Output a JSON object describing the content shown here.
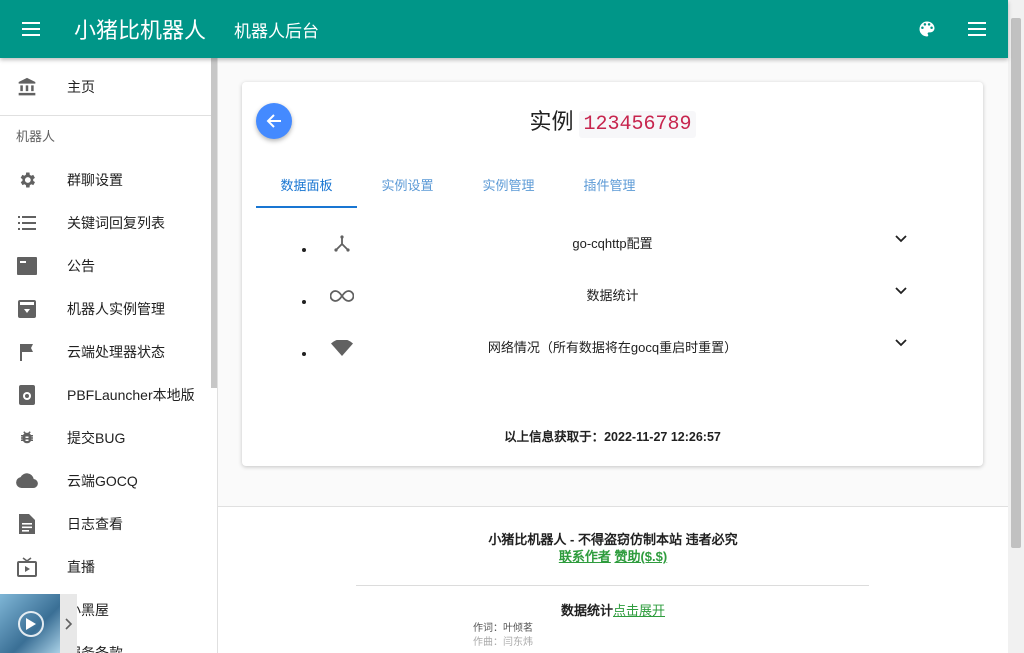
{
  "appbar": {
    "title": "小猪比机器人",
    "subtitle": "机器人后台",
    "menu_icon": "hamburger-icon",
    "palette_icon": "palette-icon",
    "more_icon": "menu-icon"
  },
  "sidebar": {
    "home_label": "主页",
    "section_header": "机器人",
    "items": [
      {
        "label": "群聊设置",
        "icon": "gear-icon"
      },
      {
        "label": "关键词回复列表",
        "icon": "list-icon"
      },
      {
        "label": "公告",
        "icon": "announcement-icon"
      },
      {
        "label": "机器人实例管理",
        "icon": "archive-icon"
      },
      {
        "label": "云端处理器状态",
        "icon": "flag-icon"
      },
      {
        "label": "PBFLauncher本地版",
        "icon": "launcher-icon"
      },
      {
        "label": "提交BUG",
        "icon": "bug-icon"
      },
      {
        "label": "云端GOCQ",
        "icon": "cloud-icon"
      },
      {
        "label": "日志查看",
        "icon": "document-icon"
      },
      {
        "label": "直播",
        "icon": "live-tv-icon"
      },
      {
        "label": "小黑屋",
        "icon": "blocked-icon"
      },
      {
        "label": "服务条款",
        "icon": "terms-icon"
      }
    ]
  },
  "card": {
    "title": "实例",
    "instance_id": "123456789",
    "tabs": [
      {
        "label": "数据面板",
        "active": true
      },
      {
        "label": "实例设置",
        "active": false
      },
      {
        "label": "实例管理",
        "active": false
      },
      {
        "label": "插件管理",
        "active": false
      }
    ],
    "panels": [
      {
        "label": "go-cqhttp配置",
        "icon": "merge-icon"
      },
      {
        "label": "数据统计",
        "icon": "infinity-icon"
      },
      {
        "label": "网络情况（所有数据将在gocq重启时重置）",
        "icon": "wifi-icon"
      }
    ],
    "fetched_label": "以上信息获取于：2022-11-27 12:26:57"
  },
  "footer": {
    "title": "小猪比机器人 - 不得盗窃仿制本站 违者必究",
    "contact_link": "联系作者",
    "donate_link": "赞助($.$)",
    "stats_label": "数据统计",
    "stats_link": "点击展开",
    "lyrics_credit": "作词：叶倾茗",
    "music_credit": "作曲：闫东炜"
  },
  "colors": {
    "primary": "#009688",
    "accent": "#448aff",
    "tab_active": "#1976d2",
    "link": "#2e9c3d",
    "code": "#c7254e"
  }
}
